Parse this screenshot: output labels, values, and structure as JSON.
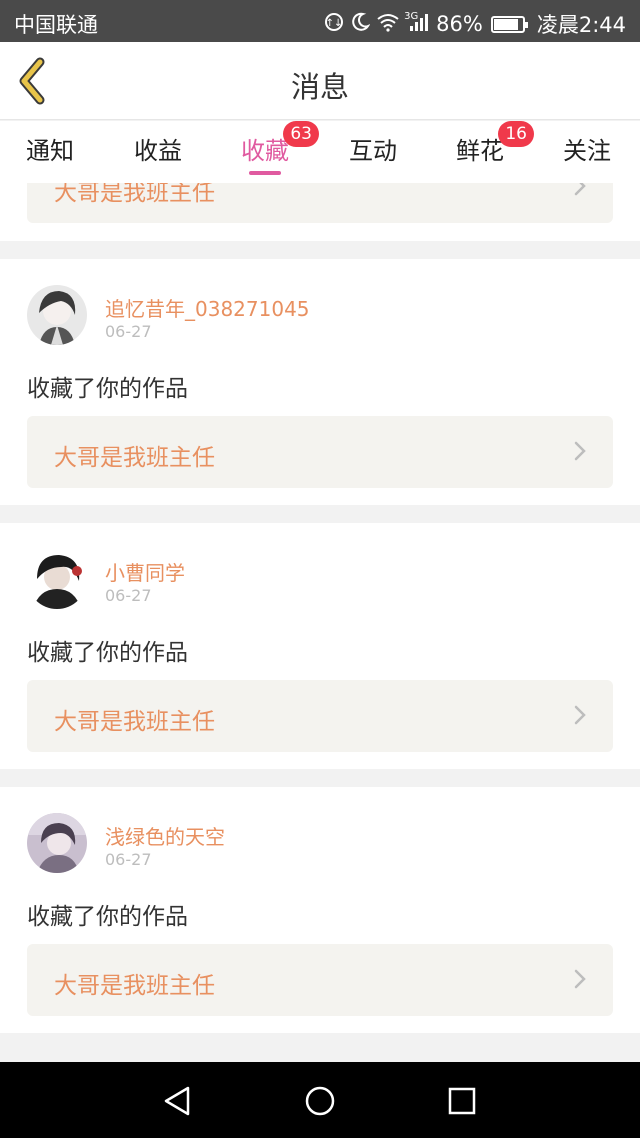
{
  "status_bar": {
    "carrier": "中国联通",
    "network": "3G",
    "battery": "86%",
    "battery_level": 0.86,
    "time": "凌晨2:44"
  },
  "header": {
    "title": "消息"
  },
  "tabs": [
    {
      "label": "通知",
      "badge": ""
    },
    {
      "label": "收益",
      "badge": ""
    },
    {
      "label": "收藏",
      "badge": "63",
      "active": true
    },
    {
      "label": "互动",
      "badge": ""
    },
    {
      "label": "鲜花",
      "badge": "16"
    },
    {
      "label": "关注",
      "badge": ""
    }
  ],
  "partial_item": {
    "work_title": "大哥是我班主任"
  },
  "items": [
    {
      "username": "追忆昔年_038271045",
      "date": "06-27",
      "action": "收藏了你的作品",
      "work_title": "大哥是我班主任"
    },
    {
      "username": "小曹同学",
      "date": "06-27",
      "action": "收藏了你的作品",
      "work_title": "大哥是我班主任"
    },
    {
      "username": "浅绿色的天空",
      "date": "06-27",
      "action": "收藏了你的作品",
      "work_title": "大哥是我班主任"
    }
  ],
  "colors": {
    "accent": "#e05aa0",
    "badge": "#f0394b",
    "name_link": "#e89060",
    "back_icon": "#e8c44a"
  }
}
